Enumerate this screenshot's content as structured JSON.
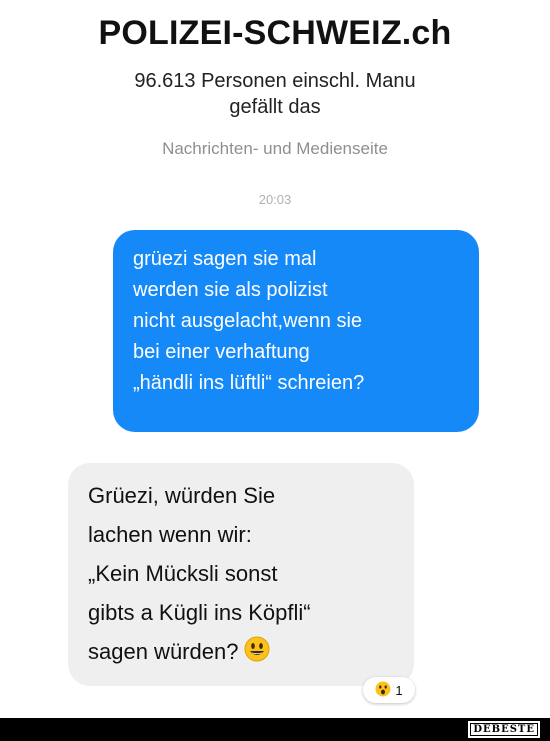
{
  "header": {
    "page_name": "POLIZEI-SCHWEIZ.ch",
    "likes_line1": "96.613 Personen einschl. Manu",
    "likes_line2": "gefällt das",
    "category": "Nachrichten- und Medienseite"
  },
  "chat": {
    "timestamp": "20:03",
    "outgoing": {
      "lines": [
        "grüezi sagen sie mal",
        "werden sie als polizist",
        "nicht ausgelacht,wenn sie",
        "bei einer verhaftung",
        "„händli ins lüftli“ schreien?"
      ],
      "color": "#1489f7"
    },
    "incoming": {
      "lines": [
        "Grüezi, würden Sie",
        "lachen wenn wir:",
        "„Kein Mücksli sonst",
        "gibts a Kügli ins Köpfli“",
        "sagen würden?"
      ],
      "emoji": "smiley-emoji",
      "color": "#efefef"
    },
    "reaction": {
      "emoji": "surprised-emoji",
      "count": "1"
    }
  },
  "watermark": "DEBESTE"
}
